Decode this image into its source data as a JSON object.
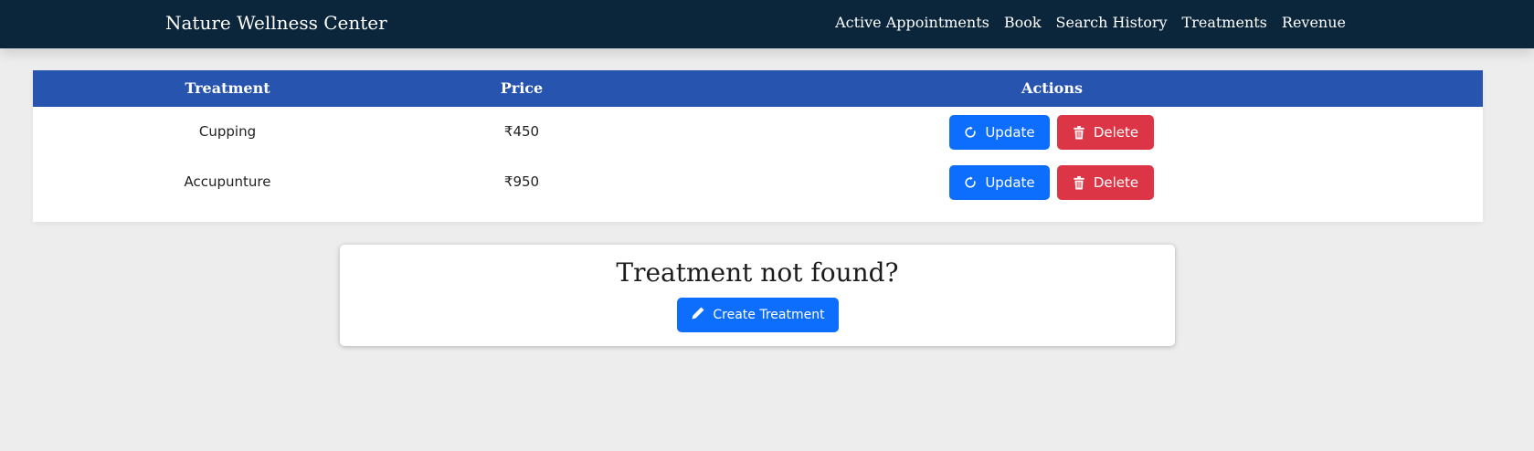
{
  "app": {
    "brand": "Nature Wellness Center"
  },
  "nav": {
    "items": [
      {
        "label": "Active Appointments"
      },
      {
        "label": "Book"
      },
      {
        "label": "Search History"
      },
      {
        "label": "Treatments"
      },
      {
        "label": "Revenue"
      }
    ]
  },
  "table": {
    "headers": {
      "treatment": "Treatment",
      "price": "Price",
      "actions": "Actions"
    },
    "rows": [
      {
        "treatment": "Cupping",
        "price": "₹450",
        "update_label": "Update",
        "delete_label": "Delete"
      },
      {
        "treatment": "Accupunture",
        "price": "₹950",
        "update_label": "Update",
        "delete_label": "Delete"
      }
    ]
  },
  "cta": {
    "title": "Treatment not found?",
    "button_label": "Create Treatment"
  },
  "icons": {
    "update": "refresh-icon",
    "delete": "trash-icon",
    "create": "pencil-icon"
  },
  "colors": {
    "navbar": "#0b253a",
    "table_header": "#2654ae",
    "primary": "#0d6efd",
    "danger": "#dc3545",
    "page_background": "#ededed"
  }
}
